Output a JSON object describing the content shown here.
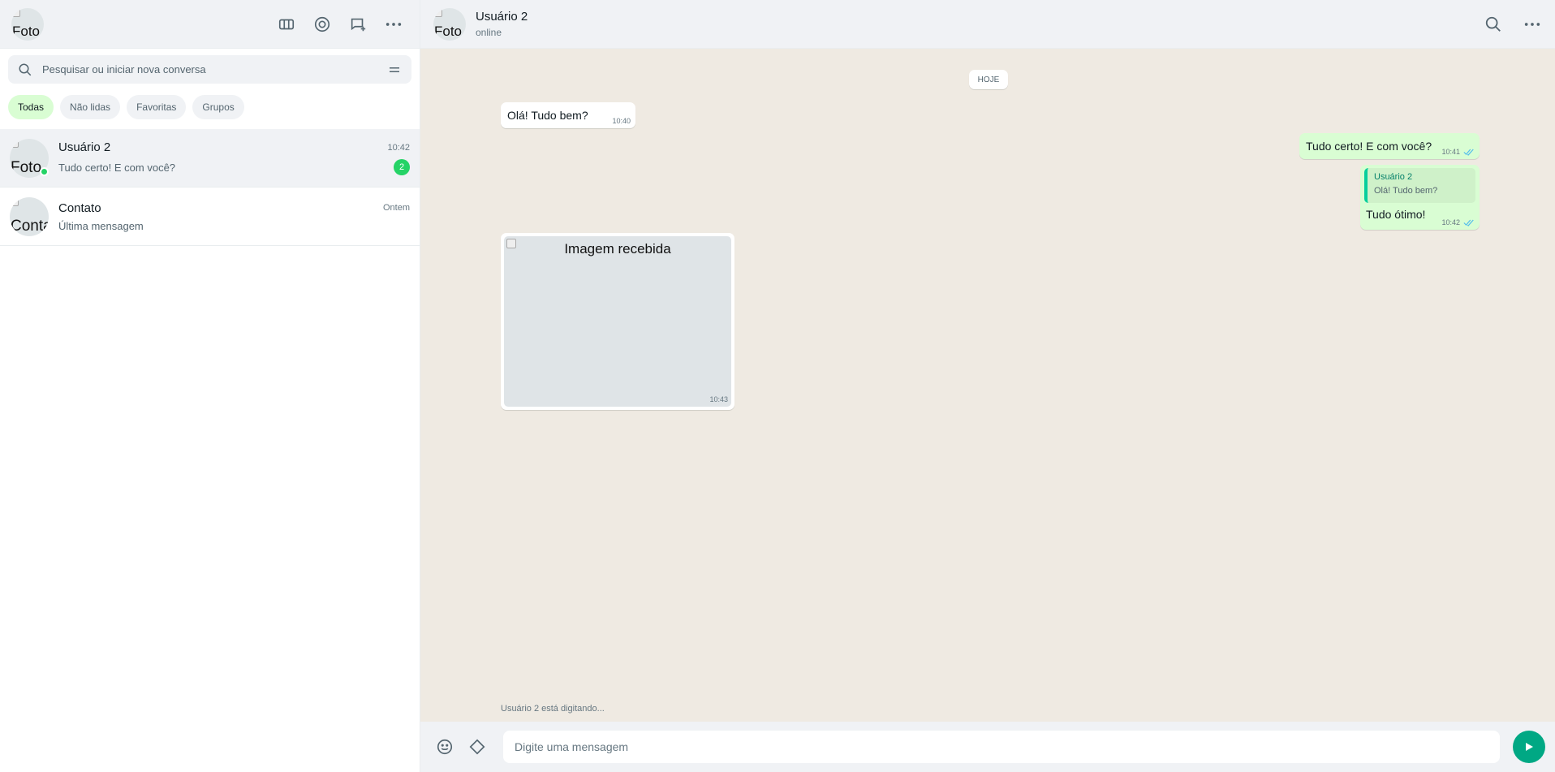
{
  "sidebar": {
    "profile_avatar_alt": "Foto",
    "search": {
      "placeholder": "Pesquisar ou iniciar nova conversa"
    },
    "filters": [
      {
        "label": "Todas"
      },
      {
        "label": "Não lidas"
      },
      {
        "label": "Favoritas"
      },
      {
        "label": "Grupos"
      }
    ],
    "chats": [
      {
        "avatar_alt": "Foto",
        "name": "Usuário 2",
        "time": "10:42",
        "last_message": "Tudo certo! E com você?",
        "unread": "2"
      },
      {
        "avatar_alt": "Contato",
        "name": "Contato",
        "time": "Ontem",
        "last_message": "Última mensagem"
      }
    ]
  },
  "chat": {
    "avatar_alt": "Foto",
    "contact_name": "Usuário 2",
    "status": "online",
    "date_separator": "HOJE",
    "messages": [
      {
        "direction": "in",
        "text": "Olá! Tudo bem?",
        "time": "10:40"
      },
      {
        "direction": "out",
        "text": "Tudo certo! E com você?",
        "time": "10:41"
      },
      {
        "direction": "out",
        "quote_author": "Usuário 2",
        "quote_text": "Olá! Tudo bem?",
        "text": "Tudo ótimo!",
        "time": "10:42"
      },
      {
        "direction": "in",
        "image_alt": "Imagem recebida",
        "time": "10:43"
      }
    ],
    "typing_indicator": "Usuário 2 está digitando...",
    "composer": {
      "placeholder": "Digite uma mensagem"
    }
  },
  "colors": {
    "accent": "#00a884",
    "online": "#25d366",
    "bubble_out": "#d9fdd3",
    "read_ticks": "#53bdeb",
    "chat_background": "#efeae2"
  }
}
